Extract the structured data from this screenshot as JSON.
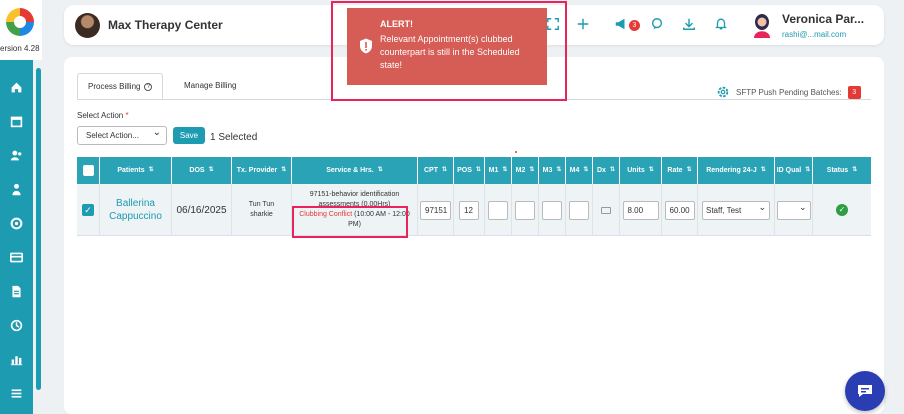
{
  "app": {
    "version": "ersion 4.28",
    "org_name": "Max Therapy Center",
    "user_name": "Veronica Par...",
    "user_email": "rashi@...mail.com",
    "notification_count": "3"
  },
  "alert": {
    "title": "ALERT!",
    "message": "Relevant Appointment(s) clubbed counterpart is still in the Scheduled state!"
  },
  "tabs": [
    {
      "label": "Process Billing",
      "active": true
    },
    {
      "label": "Manage Billing",
      "active": false
    }
  ],
  "sftp": {
    "label": "SFTP Push Pending Batches:",
    "count": "3"
  },
  "actions": {
    "label": "Select Action",
    "required_mark": "*",
    "select_value": "Select Action...",
    "save_label": "Save",
    "selected_text": "1 Selected"
  },
  "table": {
    "headers": [
      "Patients",
      "DOS",
      "Tx. Provider",
      "Service & Hrs.",
      "CPT",
      "POS",
      "M1",
      "M2",
      "M3",
      "M4",
      "Dx",
      "Units",
      "Rate",
      "Rendering 24-J",
      "ID Qual",
      "Status"
    ],
    "row": {
      "patient": "Ballerina Cappuccino",
      "dos": "06/16/2025",
      "provider": "Tun Tun sharkie",
      "service_line1": "97151-behavior identification assessments (0.00Hrs)",
      "conflict_label": "Clubbing Conflict",
      "conflict_time": " (10:00 AM - 12:00 PM)",
      "cpt": "97151",
      "pos": "12",
      "m1": "",
      "m2": "",
      "m3": "",
      "m4": "",
      "units": "8.00",
      "rate": "60.00",
      "rendering": "Staff, Test",
      "id_qual": ""
    }
  },
  "colors": {
    "accent": "#1d9bb0",
    "alert_bg": "#d65c56",
    "highlight_outline": "#e8245a",
    "conflict_text": "#e53935",
    "status_ok": "#2e9e44",
    "chat_button": "#2a3db3"
  }
}
